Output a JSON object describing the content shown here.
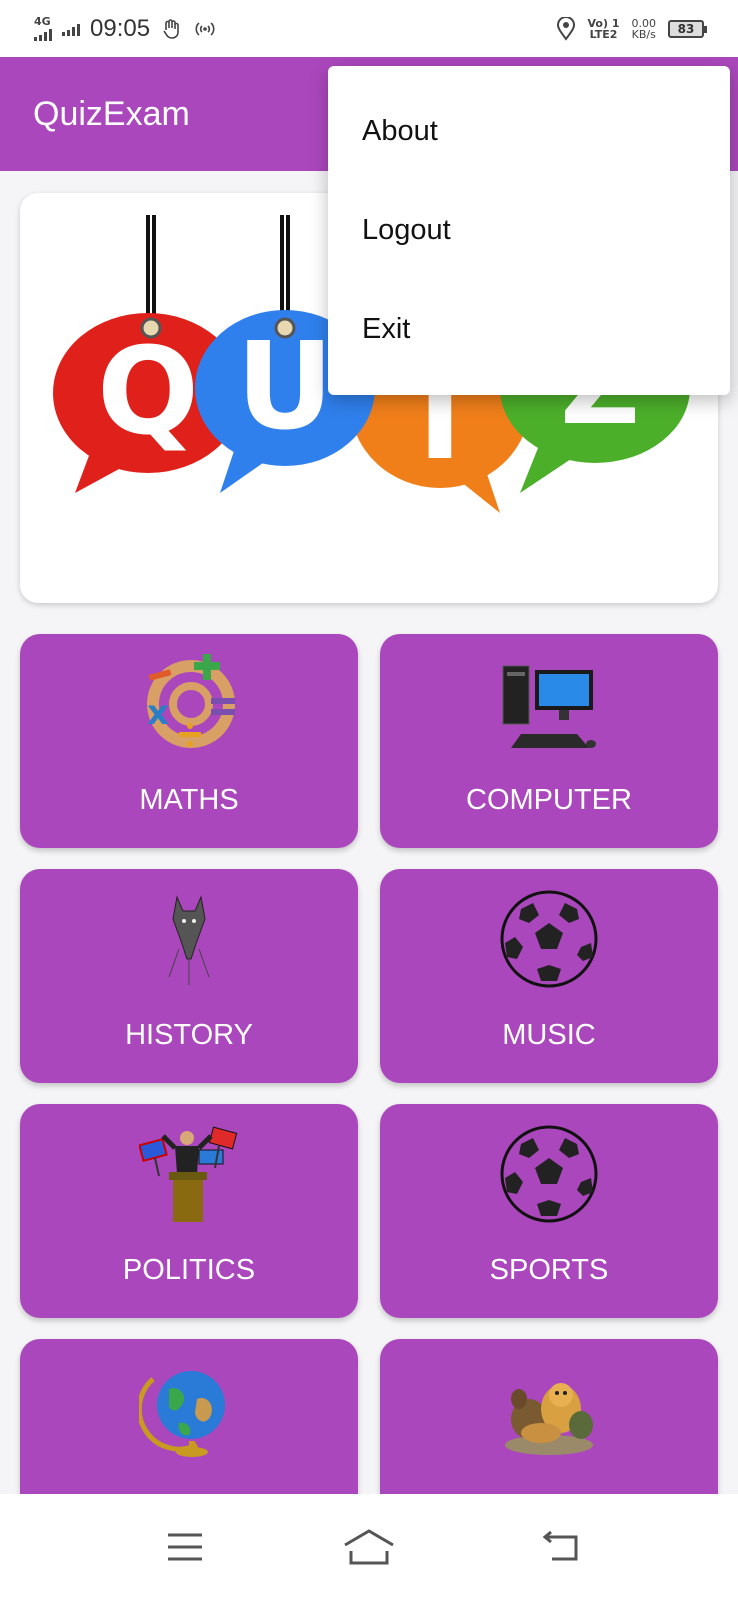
{
  "status_bar": {
    "network_type": "4G",
    "time": "09:05",
    "volte": "Vo) 1",
    "lte": "LTE2",
    "speed": "0.00",
    "speed_unit": "KB/s",
    "battery": "83"
  },
  "app_bar": {
    "title": "QuizExam"
  },
  "hero": {
    "banner_icon": "quiz-banner"
  },
  "categories": [
    {
      "label": "MATHS",
      "icon": "maths-symbols-icon"
    },
    {
      "label": "COMPUTER",
      "icon": "desktop-computer-icon"
    },
    {
      "label": "HISTORY",
      "icon": "wolf-sketch-icon"
    },
    {
      "label": "MUSIC",
      "icon": "soccer-ball-icon"
    },
    {
      "label": "POLITICS",
      "icon": "politician-podium-icon"
    },
    {
      "label": "SPORTS",
      "icon": "soccer-ball-icon"
    },
    {
      "label": "",
      "icon": "globe-icon"
    },
    {
      "label": "",
      "icon": "animals-icon"
    }
  ],
  "menu": {
    "items": [
      "About",
      "Logout",
      "Exit"
    ]
  },
  "nav": {
    "icons": [
      "menu-icon",
      "home-icon",
      "back-icon"
    ]
  },
  "colors": {
    "primary": "#ab47bc",
    "card_bg": "#ffffff"
  }
}
